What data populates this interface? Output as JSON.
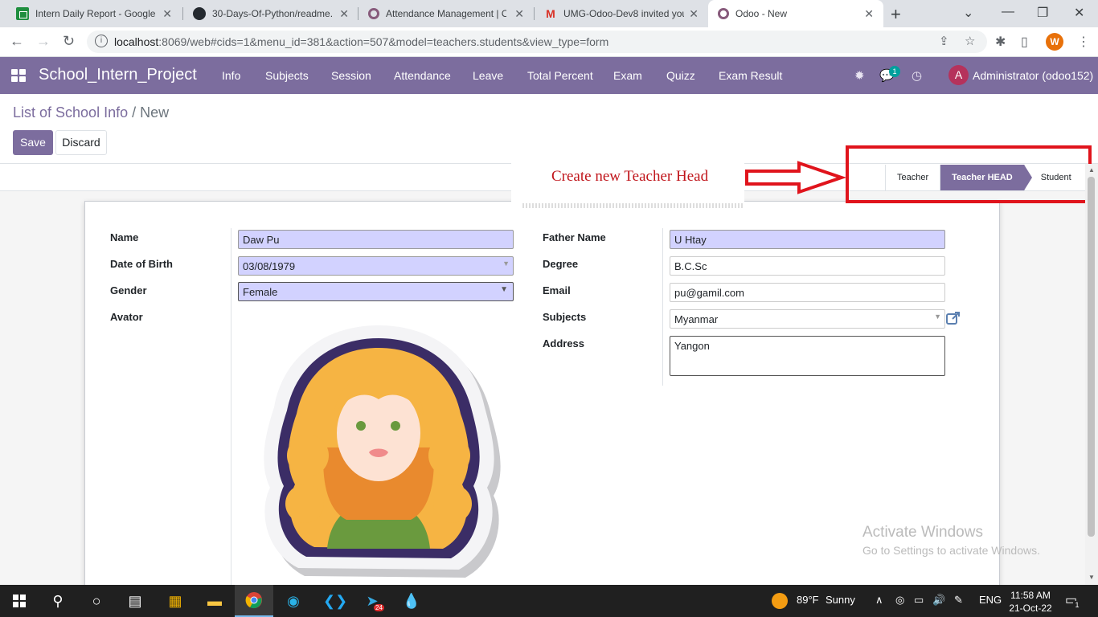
{
  "browser": {
    "tabs": [
      {
        "title": "Intern Daily Report - Google Sh",
        "icon": "sheets-icon"
      },
      {
        "title": "30-Days-Of-Python/readme.md",
        "icon": "github-icon"
      },
      {
        "title": "Attendance Management | Odoo",
        "icon": "odoo-icon"
      },
      {
        "title": "UMG-Odoo-Dev8 invited you",
        "icon": "gmail-icon"
      },
      {
        "title": "Odoo - New",
        "icon": "odoo-icon",
        "active": true
      }
    ],
    "url_host": "localhost",
    "url_rest": ":8069/web#cids=1&menu_id=381&action=507&model=teachers.students&view_type=form",
    "profile_initial": "W"
  },
  "navbar": {
    "brand": "School_Intern_Project",
    "menu": [
      "Info",
      "Subjects",
      "Session",
      "Attendance",
      "Leave",
      "Total Percent",
      "Exam",
      "Quizz",
      "Exam Result"
    ],
    "chat_badge": "1",
    "user_initial": "A",
    "user_name": "Administrator (odoo152)"
  },
  "breadcrumb": {
    "parent": "List of School Info",
    "separator": "/",
    "current": "New"
  },
  "buttons": {
    "save": "Save",
    "discard": "Discard"
  },
  "statusbar": {
    "stages": [
      "Teacher",
      "Teacher HEAD",
      "Student"
    ],
    "active": "Teacher HEAD"
  },
  "annotation": {
    "text": "Create new Teacher Head",
    "color": "#c0151b"
  },
  "form": {
    "left": {
      "name_label": "Name",
      "name_value": "Daw Pu",
      "dob_label": "Date of Birth",
      "dob_value": "03/08/1979",
      "gender_label": "Gender",
      "gender_value": "Female",
      "avatar_label": "Avator"
    },
    "right": {
      "father_label": "Father Name",
      "father_value": "U Htay",
      "degree_label": "Degree",
      "degree_value": "B.C.Sc",
      "email_label": "Email",
      "email_value": "pu@gamil.com",
      "subjects_label": "Subjects",
      "subjects_value": "Myanmar",
      "address_label": "Address",
      "address_value": "Yangon"
    }
  },
  "watermark": {
    "title": "Activate Windows",
    "subtitle": "Go to Settings to activate Windows."
  },
  "taskbar": {
    "weather_temp": "89°F",
    "weather_desc": "Sunny",
    "lang": "ENG",
    "time": "11:58 AM",
    "date": "21-Oct-22",
    "notification_count": "1",
    "telegram_badge": "24"
  },
  "colors": {
    "brand": "#7c6d9e",
    "required_field": "#d2d2ff",
    "annotation_red": "#e0141c"
  }
}
